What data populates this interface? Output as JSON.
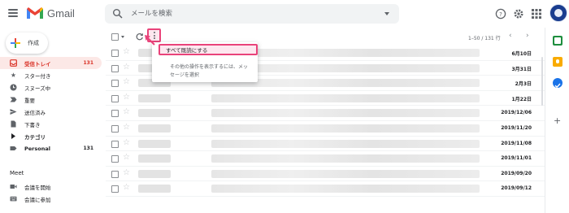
{
  "app": {
    "name": "Gmail"
  },
  "search": {
    "placeholder": "メールを検索"
  },
  "compose": {
    "label": "作成"
  },
  "sidebar": {
    "items": [
      {
        "label": "受信トレイ",
        "count": "131",
        "icon": "inbox-icon",
        "active": true
      },
      {
        "label": "スター付き",
        "count": "",
        "icon": "star-icon"
      },
      {
        "label": "スヌーズ中",
        "count": "",
        "icon": "clock-icon"
      },
      {
        "label": "重要",
        "count": "",
        "icon": "important-icon"
      },
      {
        "label": "送信済み",
        "count": "",
        "icon": "send-icon"
      },
      {
        "label": "下書き",
        "count": "",
        "icon": "draft-icon"
      },
      {
        "label": "カテゴリ",
        "count": "",
        "icon": "category-icon"
      },
      {
        "label": "Personal",
        "count": "131",
        "icon": "label-icon"
      }
    ]
  },
  "meet": {
    "heading": "Meet",
    "items": [
      {
        "label": "会議を開始",
        "icon": "video-icon"
      },
      {
        "label": "会議に参加",
        "icon": "keyboard-icon"
      }
    ]
  },
  "toolbar": {
    "pager": "1–50 / 131 行"
  },
  "menu": {
    "item": "すべて既読にする",
    "hint": "その他の操作を表示するには、メッセージを選択"
  },
  "emails": [
    {
      "date": "6月10日"
    },
    {
      "date": "3月31日"
    },
    {
      "date": "2月3日"
    },
    {
      "date": "1月22日"
    },
    {
      "date": "2019/12/06"
    },
    {
      "date": "2019/11/20"
    },
    {
      "date": "2019/11/08"
    },
    {
      "date": "2019/11/01"
    },
    {
      "date": "2019/09/20"
    },
    {
      "date": "2019/09/12"
    }
  ],
  "colors": {
    "accent": "#d93025",
    "highlight": "#e9437a",
    "inbox_bg": "#fce8e6"
  }
}
